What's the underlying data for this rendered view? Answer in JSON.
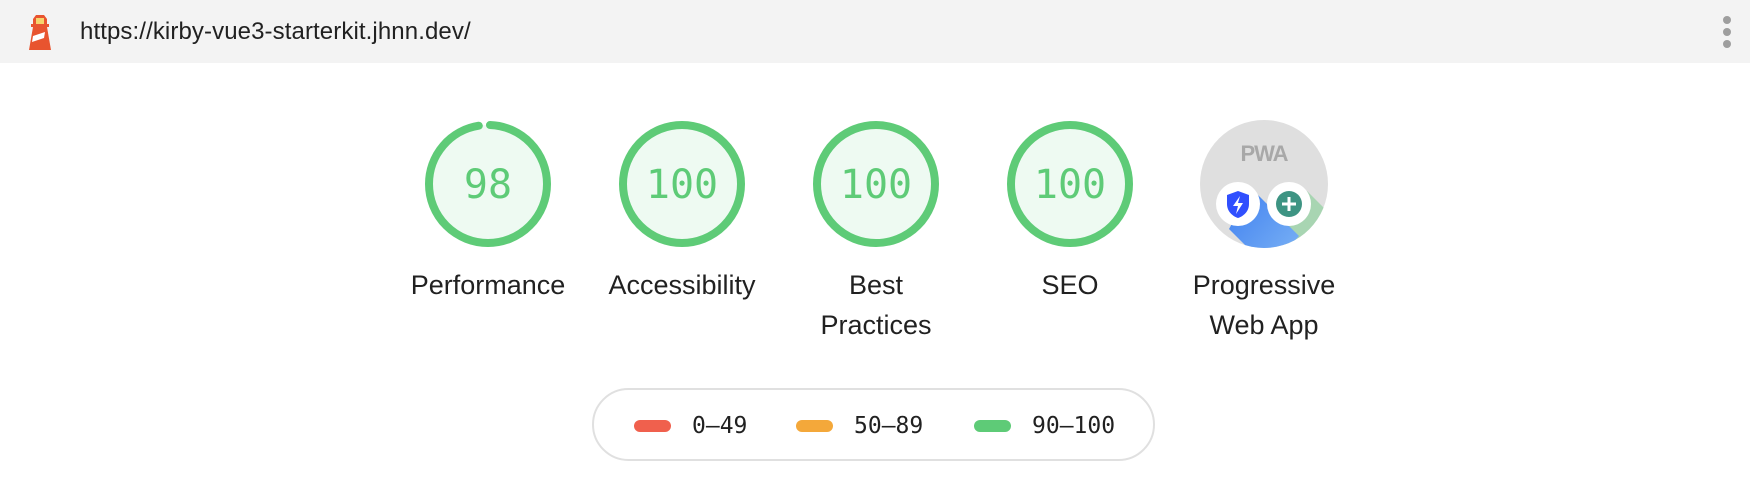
{
  "topbar": {
    "icon": "lighthouse-icon",
    "url": "https://kirby-vue3-starterkit.jhnn.dev/",
    "menu_icon": "more-vert-icon"
  },
  "gauges": [
    {
      "label": "Performance",
      "score": 98,
      "display": "98",
      "color": "#0cce6b"
    },
    {
      "label": "Accessibility",
      "score": 100,
      "display": "100",
      "color": "#0cce6b"
    },
    {
      "label_line1": "Best",
      "label_line2": "Practices",
      "score": 100,
      "display": "100",
      "color": "#0cce6b"
    },
    {
      "label": "SEO",
      "score": 100,
      "display": "100",
      "color": "#0cce6b"
    }
  ],
  "pwa": {
    "label_line1": "Progressive",
    "label_line2": "Web App",
    "badge_text": "PWA",
    "badges": [
      "fast-reliable-shield-icon",
      "installable-plus-icon"
    ]
  },
  "legend": [
    {
      "range": "0–49",
      "color": "#f0604d"
    },
    {
      "range": "50–89",
      "color": "#f4a83a"
    },
    {
      "range": "90–100",
      "color": "#5ecb77"
    }
  ],
  "colors": {
    "pass": "#5ecb77",
    "pass_bg": "#eefaf2",
    "average": "#f4a83a",
    "fail": "#f0604d"
  }
}
